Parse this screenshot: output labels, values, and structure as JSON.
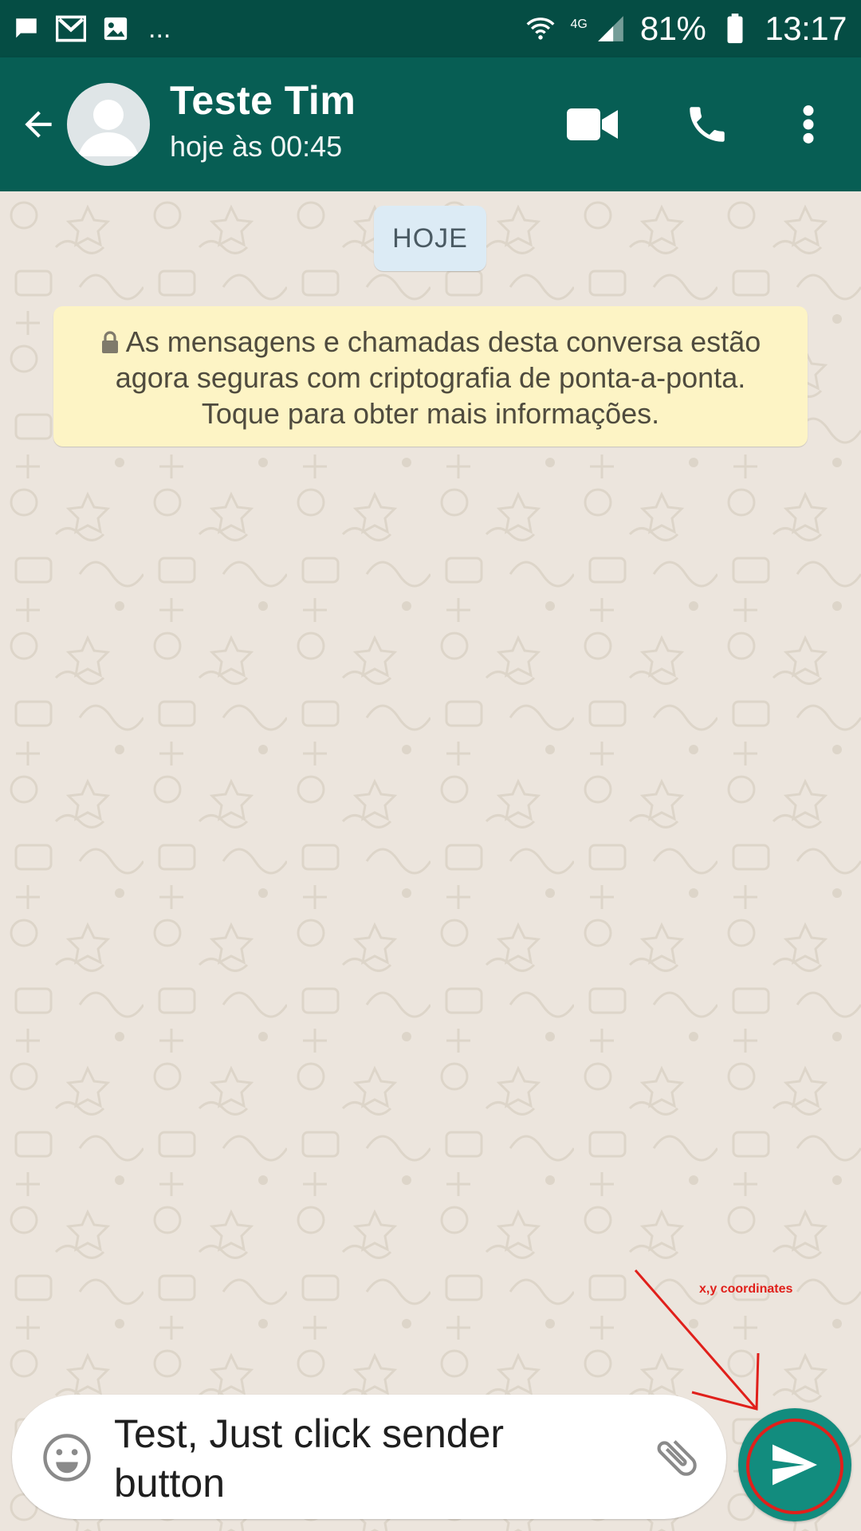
{
  "status_bar": {
    "left_icons": [
      "chat-notification-icon",
      "gmail-icon",
      "gallery-icon"
    ],
    "more": "...",
    "network": "4G",
    "battery": "81%",
    "time": "13:17"
  },
  "header": {
    "contact_name": "Teste Tim",
    "last_seen": "hoje às 00:45",
    "actions": [
      "video-call-icon",
      "voice-call-icon",
      "more-vert-icon"
    ],
    "color": "#075e54"
  },
  "chat": {
    "date_chip": "HOJE",
    "encryption_notice": "As mensagens e chamadas desta conversa estão agora seguras com criptografia de ponta-a-ponta. Toque para obter mais informações."
  },
  "composer": {
    "message_text": "Test, Just click sender button",
    "send_color": "#128c7e"
  },
  "annotation": {
    "label": "x,y coordinates",
    "color": "#e0201b"
  }
}
